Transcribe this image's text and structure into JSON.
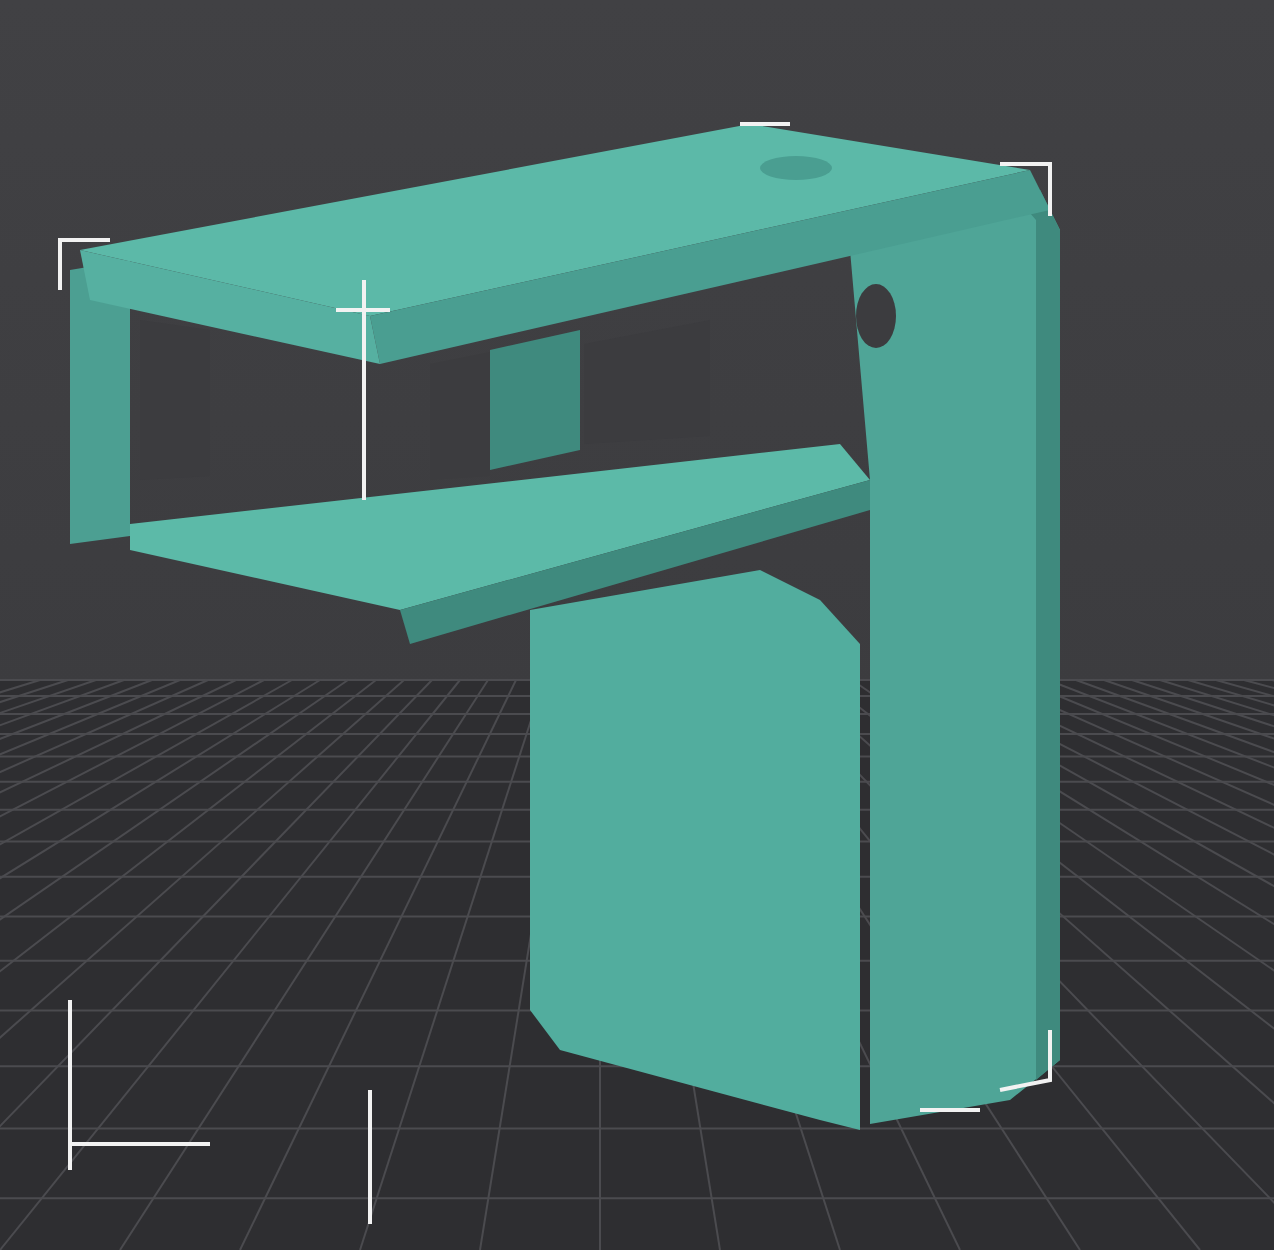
{
  "viewport": {
    "model_selected": true
  }
}
